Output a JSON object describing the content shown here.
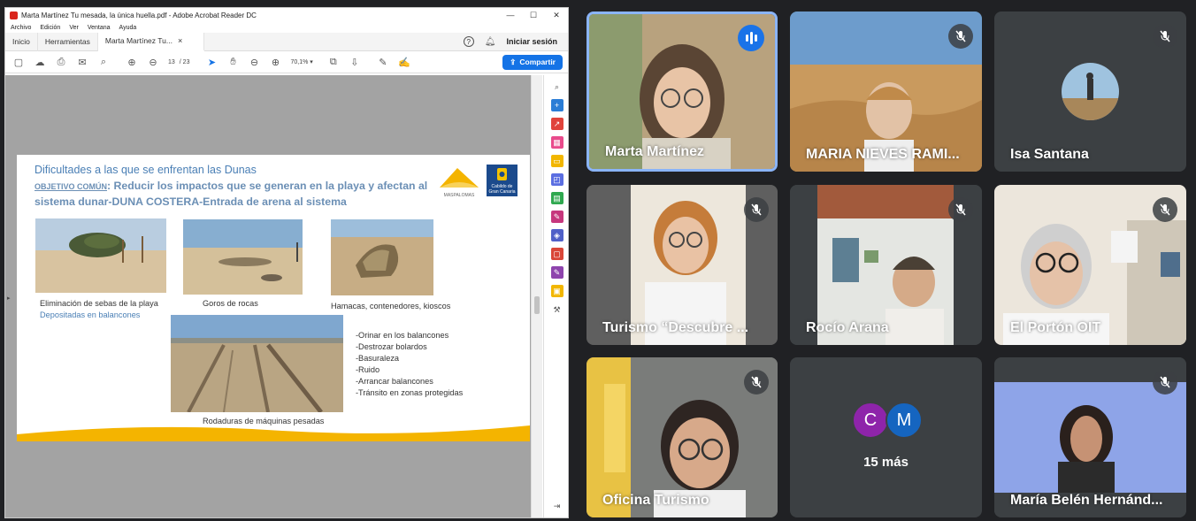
{
  "acrobat": {
    "window_title": "Marta Martínez  Tu mesada, la única huella.pdf - Adobe Acrobat Reader DC",
    "menu": [
      "Archivo",
      "Edición",
      "Ver",
      "Ventana",
      "Ayuda"
    ],
    "tabs": [
      "Inicio",
      "Herramientas",
      "Marta Martínez  Tu..."
    ],
    "tab_close": "×",
    "help_icon_label": "?",
    "login": "Iniciar sesión",
    "page_current": "13",
    "page_total": "/ 23",
    "zoom": "70,1%",
    "share_label": "Compartir"
  },
  "slide": {
    "title": "Dificultades a las que se enfrentan las Dunas",
    "objective_label": "OBJETIVO COMÚN",
    "objective_text": ": Reducir los impactos que se generan en la playa y afectan al sistema dunar-DUNA COSTERA-Entrada de arena al sistema",
    "logo1_text": "MASPALOMAS",
    "logo2_text": "Cabildo de Gran Canaria",
    "captions": {
      "photo1": "Eliminación de sebas de la playa",
      "photo1_sub": "Depositadas en balancones",
      "photo2": "Goros de rocas",
      "photo3": "Hamacas, contenedores, kioscos",
      "photo4": "Rodaduras de máquinas pesadas"
    },
    "list": [
      "-Orinar en los balancones",
      "-Destrozar bolardos",
      "-Basuraleza",
      "-Ruido",
      "-Arrancar balancones",
      "-Tránsito en zonas protegidas"
    ]
  },
  "meet": {
    "participants": [
      {
        "name": "Marta Martínez",
        "state": "speaking"
      },
      {
        "name": "MARIA NIEVES RAMI...",
        "state": "muted"
      },
      {
        "name": "Isa Santana",
        "state": "muted"
      },
      {
        "name": "Turismo “Descubre ...",
        "state": "muted"
      },
      {
        "name": "Rocío Arana",
        "state": "muted"
      },
      {
        "name": "El Portón OIT",
        "state": "muted"
      },
      {
        "name": "Oficina Turismo",
        "state": "muted"
      },
      {
        "name": "María Belén Hernánd...",
        "state": "muted"
      }
    ],
    "more_avatars": [
      "C",
      "M"
    ],
    "more_label": "15 más",
    "colors": {
      "speaking_border": "#8ab4f8",
      "avatar_c": "#8e24aa",
      "avatar_m": "#1565c0",
      "tile_bg": "#3c4043"
    }
  }
}
